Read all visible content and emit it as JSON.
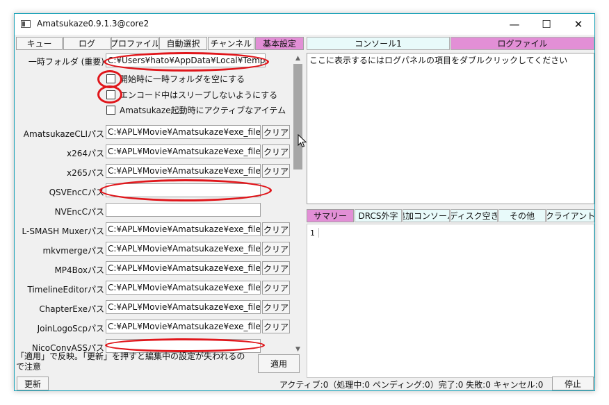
{
  "window": {
    "title": "Amatsukaze0.9.1.3@core2",
    "minimize_glyph": "—",
    "maximize_glyph": "☐",
    "close_glyph": "✕"
  },
  "left_tabs": [
    {
      "label": "キュー",
      "active": false
    },
    {
      "label": "ログ",
      "active": false
    },
    {
      "label": "プロファイル",
      "active": false
    },
    {
      "label": "自動選択",
      "active": false
    },
    {
      "label": "チャンネル",
      "active": false
    },
    {
      "label": "基本設定",
      "active": true
    }
  ],
  "right_top_tabs": [
    {
      "label": "コンソール1",
      "active": false
    },
    {
      "label": "ログファイル",
      "active": true
    }
  ],
  "settings": {
    "temp_folder": {
      "label": "一時フォルダ (重要)",
      "value": "C:¥Users¥hato¥AppData¥Local¥Temp"
    },
    "checkboxes": [
      {
        "label": "開始時に一時フォルダを空にする",
        "checked": false
      },
      {
        "label": "エンコード中はスリープしないようにする",
        "checked": false
      },
      {
        "label": "Amatsukaze起動時にアクティブなアイテム",
        "checked": false
      }
    ],
    "clear_label": "クリア",
    "paths": [
      {
        "label": "AmatsukazeCLIパス",
        "value": "C:¥APL¥Movie¥Amatsukaze¥exe_files",
        "clear": true
      },
      {
        "label": "x264パス",
        "value": "C:¥APL¥Movie¥Amatsukaze¥exe_files",
        "clear": true
      },
      {
        "label": "x265パス",
        "value": "C:¥APL¥Movie¥Amatsukaze¥exe_files",
        "clear": true
      },
      {
        "label": "QSVEncCパス",
        "value": "",
        "clear": false
      },
      {
        "label": "NVEncCパス",
        "value": "",
        "clear": false
      },
      {
        "label": "L-SMASH Muxerパス",
        "value": "C:¥APL¥Movie¥Amatsukaze¥exe_files",
        "clear": true
      },
      {
        "label": "mkvmergeパス",
        "value": "C:¥APL¥Movie¥Amatsukaze¥exe_files",
        "clear": true
      },
      {
        "label": "MP4Boxパス",
        "value": "C:¥APL¥Movie¥Amatsukaze¥exe_files",
        "clear": true
      },
      {
        "label": "TimelineEditorパス",
        "value": "C:¥APL¥Movie¥Amatsukaze¥exe_files",
        "clear": true
      },
      {
        "label": "ChapterExeパス",
        "value": "C:¥APL¥Movie¥Amatsukaze¥exe_files",
        "clear": true
      },
      {
        "label": "JoinLogoScpパス",
        "value": "C:¥APL¥Movie¥Amatsukaze¥exe_files",
        "clear": true
      },
      {
        "label": "NicoConvASSパス",
        "value": "",
        "clear": false
      }
    ]
  },
  "note": "「適用」で反映。「更新」を押すと編集中の設定が失われるので注意",
  "apply_label": "適用",
  "console": {
    "text": "ここに表示するにはログパネルの項目をダブルクリックしてください"
  },
  "bottom_tabs": [
    {
      "label": "サマリー",
      "active": true
    },
    {
      "label": "DRCS外字",
      "active": false
    },
    {
      "label": "追加コンソール",
      "active": false
    },
    {
      "label": "ディスク空き",
      "active": false
    },
    {
      "label": "その他",
      "active": false
    },
    {
      "label": "クライアント",
      "active": false
    }
  ],
  "summary": {
    "line_number": "1"
  },
  "statusbar": {
    "refresh_label": "更新",
    "status": "アクティブ:0（処理中:0 ペンディング:0）完了:0 失敗:0 キャンセル:0",
    "stop_label": "停止"
  },
  "colors": {
    "accent": "#e28fd6",
    "annotation_red": "#e0161b",
    "window_border": "#17a2b8"
  }
}
